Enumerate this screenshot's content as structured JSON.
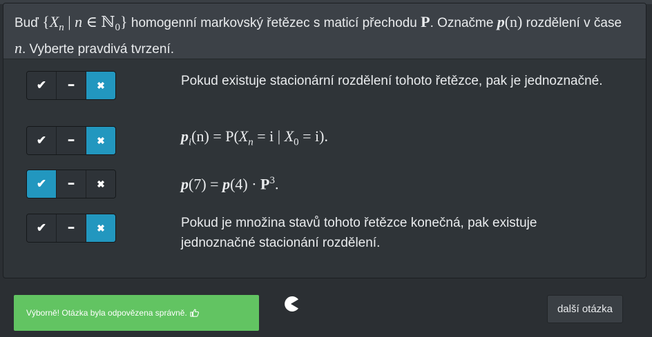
{
  "question": {
    "t1": "Buď ",
    "set_open": "{",
    "X": "X",
    "n_sub": "n",
    "bar": " | ",
    "n": "n",
    "in": " ∈ ",
    "N": "ℕ",
    "zero": "0",
    "set_close": "}",
    "t2": " homogenní markovský řetězec s maticí přechodu ",
    "P": "P",
    "t3": ". Označme ",
    "p": "p",
    "pn": "(n)",
    "t4": " rozdělení v čase ",
    "n2": "n",
    "t5": ". Vyberte pravdivá tvrzení."
  },
  "answer_buttons": {
    "yes": "✔",
    "neutral": "━",
    "no": "✖"
  },
  "statements": [
    {
      "text": "Pokud existuje stacionární rozdělení tohoto řetězce, pak je jednoznačné.",
      "selected": "no"
    },
    {
      "math_p": "p",
      "math_i": "i",
      "math_rest1": "(n) = P(",
      "math_X": "X",
      "math_n": "n",
      "math_rest2": " = i | ",
      "math_X0": "X",
      "math_0": "0",
      "math_rest3": " = i).",
      "selected": "no"
    },
    {
      "m_p1": "p",
      "m_a": "(7) = ",
      "m_p2": "p",
      "m_b": "(4) · ",
      "m_P": "P",
      "m_exp": "3",
      "m_dot": ".",
      "selected": "yes"
    },
    {
      "text": "Pokud je množina stavů tohoto řetězce konečná, pak existuje jednoznačné stacionání rozdělení.",
      "selected": "no"
    }
  ],
  "feedback": {
    "text": "Výborně! Otázka byla odpovězena správně.",
    "icon": "thumbs-up-icon",
    "color": "#62c462"
  },
  "next_button": "další otázka",
  "colors": {
    "active": "#2297bf",
    "background": "#2b2f33",
    "header": "#3c4147"
  }
}
